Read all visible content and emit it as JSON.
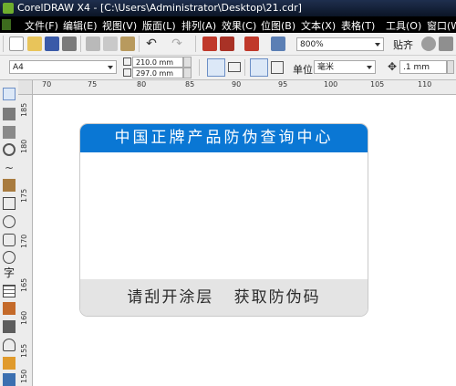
{
  "window": {
    "title": "CorelDRAW X4 - [C:\\Users\\Administrator\\Desktop\\21.cdr]"
  },
  "menu": {
    "items": [
      "文件(F)",
      "编辑(E)",
      "视图(V)",
      "版面(L)",
      "排列(A)",
      "效果(C)",
      "位图(B)",
      "文本(X)",
      "表格(T)",
      "工具(O)",
      "窗口(W)"
    ]
  },
  "toolbar": {
    "zoom_value": "800%",
    "snap_label": "贴齐"
  },
  "property_bar": {
    "page_size": "A4",
    "width": "210.0 mm",
    "height": "297.0 mm",
    "unit_label": "单位:",
    "unit_value": "毫米",
    "nudge_value": ".1 mm"
  },
  "rulers": {
    "horizontal": [
      "70",
      "75",
      "80",
      "85",
      "90",
      "95",
      "100",
      "105",
      "110"
    ],
    "vertical": [
      "185",
      "180",
      "175",
      "170",
      "165",
      "160",
      "155",
      "150"
    ]
  },
  "card": {
    "header_text": "中国正牌产品防伪查询中心",
    "footer_text": "请刮开涂层   获取防伪码"
  },
  "colors": {
    "accent": "#0a77d4",
    "footer_bg": "#e4e4e4",
    "menubar_bg": "#000000"
  }
}
